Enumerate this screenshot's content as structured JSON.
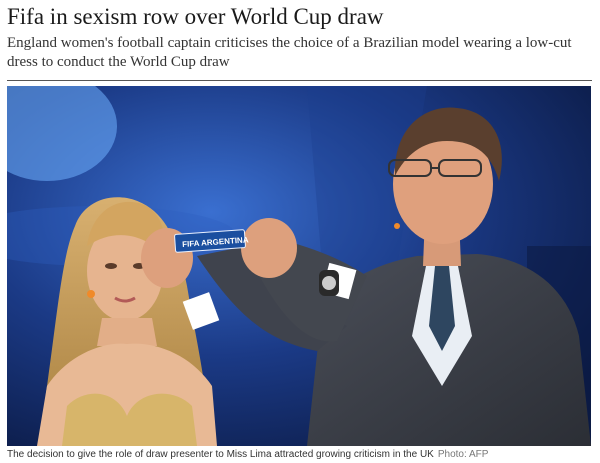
{
  "article": {
    "headline": "Fifa in sexism row over World Cup draw",
    "standfirst": "England women's football captain criticises the choice of a Brazilian model wearing a low-cut dress to conduct the World Cup draw"
  },
  "photo": {
    "slip_text": "FIFA ARGENTINA"
  },
  "caption": {
    "text": "The decision to give the role of draw presenter to Miss Lima attracted growing criticism in the UK",
    "credit": "Photo: AFP"
  },
  "colors": {
    "backdrop": "#13265c",
    "slip": "#1b4fa0",
    "suit": "#3b3f48"
  }
}
